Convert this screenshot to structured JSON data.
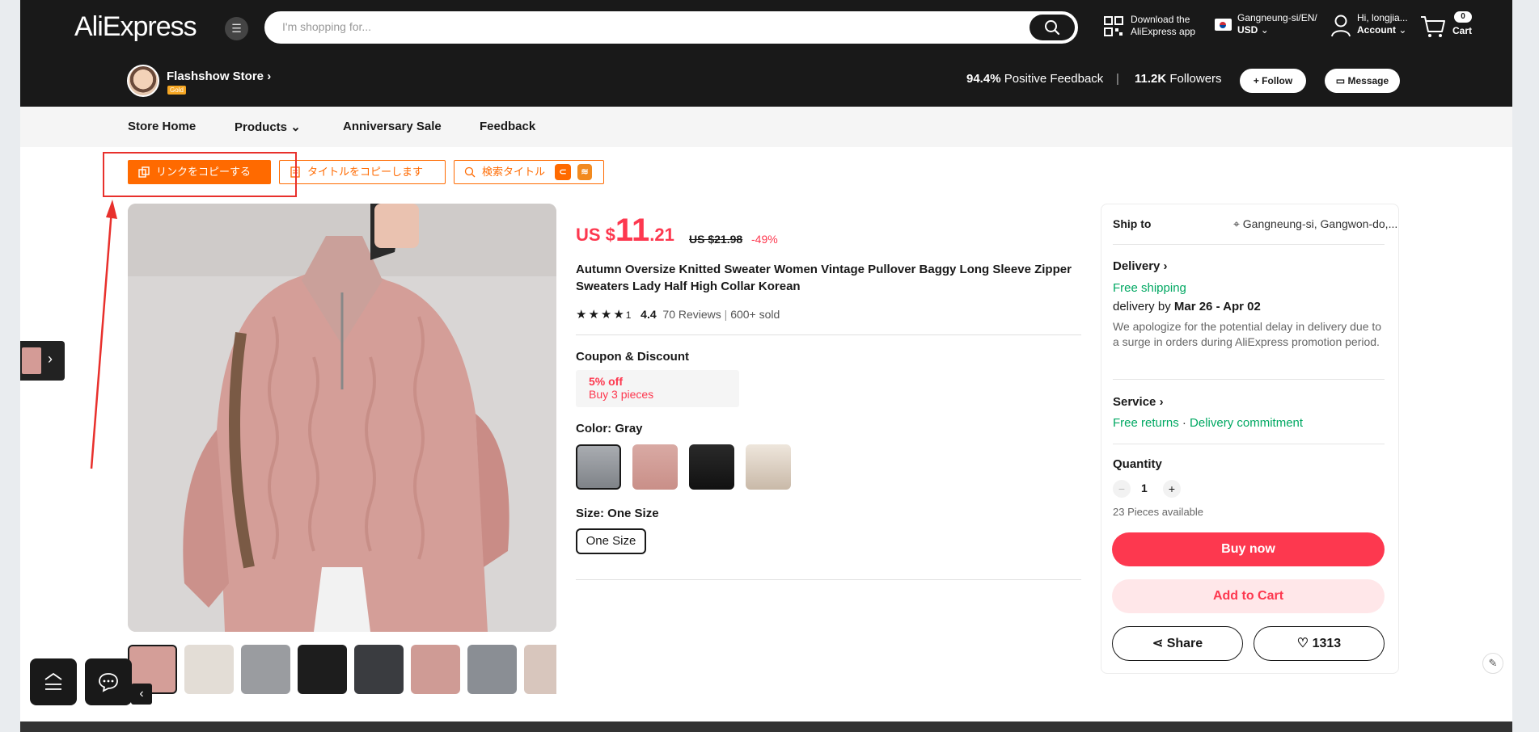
{
  "header": {
    "logo": "AliExpress",
    "search_placeholder": "I'm shopping for...",
    "app_line1": "Download the",
    "app_line2": "AliExpress app",
    "region_line1": "Gangneung-si/EN/",
    "region_line2": "USD",
    "account_line1": "Hi, longjia...",
    "account_line2": "Account",
    "cart_count": "0",
    "cart_label": "Cart"
  },
  "store": {
    "name": "Flashshow Store",
    "badge": "Gold",
    "feedback_value": "94.4%",
    "feedback_label": "Positive Feedback",
    "followers_value": "11.2K",
    "followers_label": "Followers",
    "follow_label": "+ Follow",
    "message_label": "Message"
  },
  "store_nav": {
    "home": "Store Home",
    "products": "Products",
    "sale": "Anniversary Sale",
    "feedback": "Feedback"
  },
  "extension": {
    "copy_link": "リンクをコピーする",
    "copy_title": "タイトルをコピーします",
    "search_title": "検索タイトル"
  },
  "product": {
    "currency": "US $",
    "price_int": "11",
    "price_dec": ".21",
    "old_price": "US $21.98",
    "discount": "-49%",
    "title": "Autumn Oversize Knitted Sweater Women Vintage Pullover Baggy Long Sleeve Zipper Sweaters Lady Half High Collar Korean",
    "stars": "★★★★",
    "star_partial": "1",
    "rating": "4.4",
    "reviews": "70 Reviews",
    "sold": "600+ sold",
    "coupon_title": "Coupon & Discount",
    "coupon_a": "5% off",
    "coupon_b": "Buy 3 pieces",
    "color_label": "Color: Gray",
    "size_label": "Size: One Size",
    "size_value": "One Size"
  },
  "shipping": {
    "ship_to_label": "Ship to",
    "ship_to_value": "Gangneung-si, Gangwon-do,...",
    "delivery_label": "Delivery",
    "free_shipping": "Free shipping",
    "delivery_by": "delivery by",
    "delivery_dates": "Mar 26 - Apr 02",
    "delay_note": "We apologize for the potential delay in delivery due to a surge in orders during AliExpress promotion period.",
    "service_label": "Service",
    "free_returns": "Free returns",
    "dot": "·",
    "commitment": "Delivery commitment",
    "quantity_label": "Quantity",
    "quantity_minus": "−",
    "quantity_value": "1",
    "quantity_plus": "+",
    "available": "23 Pieces available",
    "buy_now": "Buy now",
    "add_to_cart": "Add to Cart",
    "share": "Share",
    "wishlist_count": "1313"
  },
  "colors": {
    "accent": "#fd384f",
    "extension": "#ff6a00",
    "header_bg": "#191919",
    "green": "#00a862"
  }
}
